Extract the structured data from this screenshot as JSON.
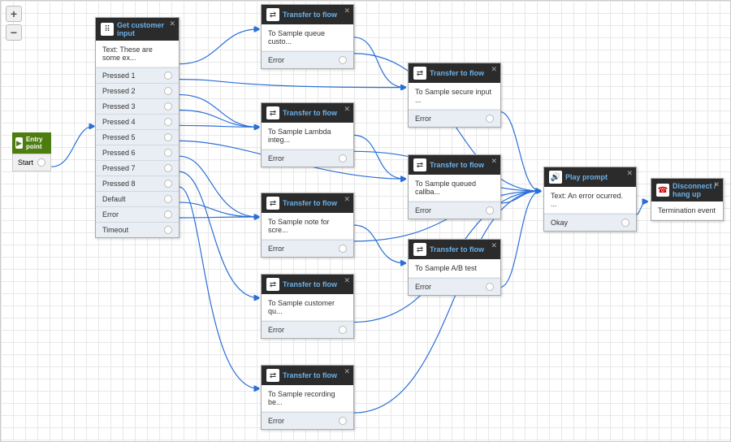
{
  "zoom": {
    "in": "+",
    "out": "−"
  },
  "entry": {
    "title": "Entry point",
    "port": "Start"
  },
  "gci": {
    "title": "Get customer input",
    "body": "Text: These are some ex...",
    "ports": [
      "Pressed 1",
      "Pressed 2",
      "Pressed 3",
      "Pressed 4",
      "Pressed 5",
      "Pressed 6",
      "Pressed 7",
      "Pressed 8",
      "Default",
      "Error",
      "Timeout"
    ]
  },
  "transfer_title": "Transfer to flow",
  "tf1": {
    "body": "To Sample queue custo...",
    "error": "Error"
  },
  "tf2": {
    "body": "To Sample Lambda integ...",
    "error": "Error"
  },
  "tf3": {
    "body": "To Sample note for scre...",
    "error": "Error"
  },
  "tf4": {
    "body": "To Sample customer qu...",
    "error": "Error"
  },
  "tf5": {
    "body": "To Sample recording be...",
    "error": "Error"
  },
  "tf6": {
    "body": "To Sample secure input ...",
    "error": "Error"
  },
  "tf7": {
    "body": "To Sample queued callba...",
    "error": "Error"
  },
  "tf8": {
    "body": "To Sample A/B test",
    "error": "Error"
  },
  "pp": {
    "title": "Play prompt",
    "body": "Text: An error ocurred. ...",
    "port": "Okay"
  },
  "dc": {
    "title": "Disconnect / hang up",
    "body": "Termination event"
  }
}
